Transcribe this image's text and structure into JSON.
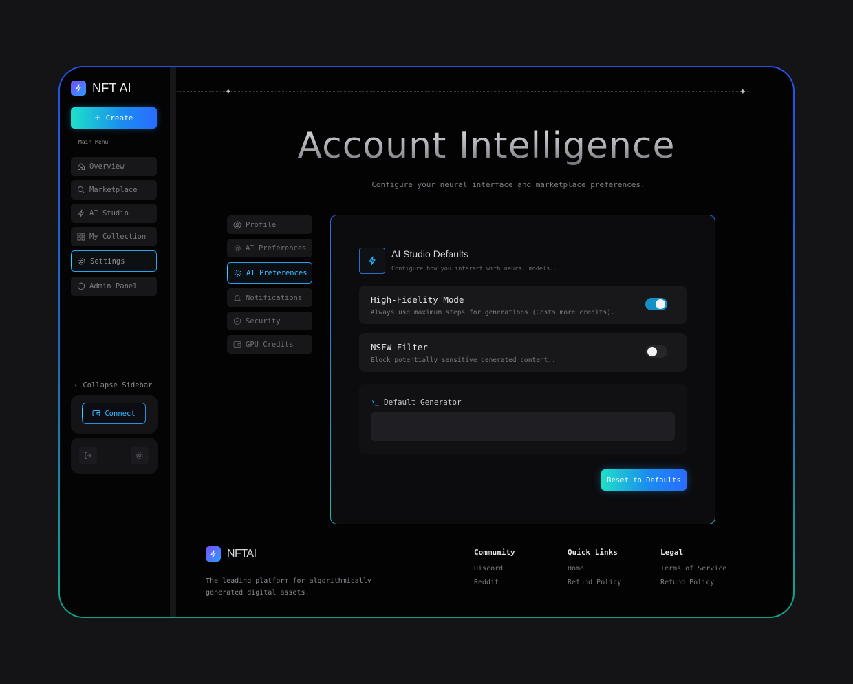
{
  "app": {
    "name": "NFT AI",
    "footer_name": "NFTAI"
  },
  "sidebar": {
    "create_label": "Create",
    "menu_label": "Main Menu",
    "items": [
      {
        "label": "Overview",
        "icon": "home-icon"
      },
      {
        "label": "Marketplace",
        "icon": "search-icon"
      },
      {
        "label": "AI Studio",
        "icon": "bolt-icon"
      },
      {
        "label": "My Collection",
        "icon": "grid-icon"
      },
      {
        "label": "Settings",
        "icon": "gear-icon",
        "active": true
      },
      {
        "label": "Admin Panel",
        "icon": "shield-icon"
      }
    ],
    "collapse_label": "Collapse Sidebar",
    "connect_label": "Connect"
  },
  "hero": {
    "title": "Account Intelligence",
    "subtitle": "Configure your neural interface and marketplace preferences."
  },
  "settings_tabs": [
    {
      "label": "Profile",
      "icon": "user-icon"
    },
    {
      "label": "AI Preferences",
      "icon": "cpu-icon"
    },
    {
      "label": "AI Preferences",
      "icon": "cpu-icon",
      "active": true
    },
    {
      "label": "Notifications",
      "icon": "bell-icon"
    },
    {
      "label": "Security",
      "icon": "shield-icon"
    },
    {
      "label": "GPU Credits",
      "icon": "wallet-icon"
    }
  ],
  "panel": {
    "title": "AI Studio Defaults",
    "subtitle": "Configure how you interact with neural models..",
    "options": [
      {
        "title": "High-Fidelity Mode",
        "desc": "Always use maximum steps for generations (Costs more credits).",
        "enabled": true
      },
      {
        "title": "NSFW Filter",
        "desc": "Block potentially sensitive generated content..",
        "enabled": false
      }
    ],
    "generator_label": "Default Generator",
    "generator_value": "",
    "reset_label": "Reset to Defaults"
  },
  "footer": {
    "description": "The leading platform for algorithmically generated digital assets.",
    "columns": [
      {
        "heading": "Community",
        "links": [
          "Discord",
          "Reddit"
        ]
      },
      {
        "heading": "Quick Links",
        "links": [
          "Home",
          "Refund Policy"
        ]
      },
      {
        "heading": "Legal",
        "links": [
          "Terms of Service",
          "Refund Policy"
        ]
      }
    ]
  },
  "colors": {
    "accent": "#1a8cf0",
    "accent_teal": "#1ee0c8",
    "background": "#030304"
  }
}
